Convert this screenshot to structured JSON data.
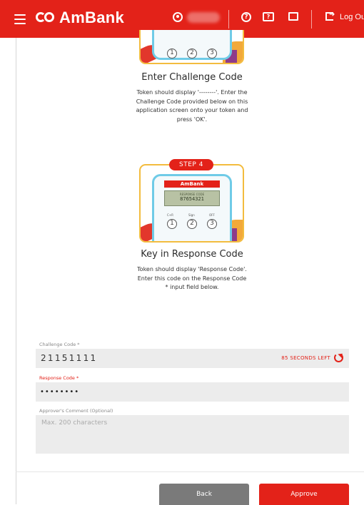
{
  "header": {
    "brand": "AmBank",
    "logout_label": "Log Out",
    "icons": [
      "menu-icon",
      "user-icon",
      "help-icon",
      "faq-icon",
      "message-icon",
      "logout-icon"
    ],
    "background_color": "#e32219"
  },
  "steps": {
    "step3": {
      "key_labels": [
        "1",
        "2",
        "3"
      ],
      "title": "Enter Challenge Code",
      "description": "Token should display '--------'. Enter the Challenge Code provided below on this application screen onto your token and press 'OK'."
    },
    "step4": {
      "badge": "STEP 4",
      "device_brand": "AmBank",
      "device_screen_label": "RESPONSE CODE",
      "device_screen_value": "87654321",
      "key_captions": [
        "C+R",
        "Sign",
        "OFF"
      ],
      "key_labels": [
        "1",
        "2",
        "3"
      ],
      "title": "Key in Response Code",
      "description": "Token should display 'Response Code'. Enter this code on the Response Code * input field below."
    }
  },
  "form": {
    "challenge_label": "Challenge Code *",
    "challenge_value": "21151111",
    "timer_text": "85 SECONDS LEFT",
    "response_label": "Response Code *",
    "response_value": "••••••••",
    "comment_label": "Approver's Comment (Optional)",
    "comment_placeholder": "Max. 200 characters"
  },
  "actions": {
    "back_label": "Back",
    "approve_label": "Approve"
  },
  "colors": {
    "brand_red": "#e32219",
    "back_grey": "#7a7a7a",
    "step_border": "#f3bc3e",
    "device_border": "#6fcbe7",
    "field_bg": "#ececec"
  }
}
